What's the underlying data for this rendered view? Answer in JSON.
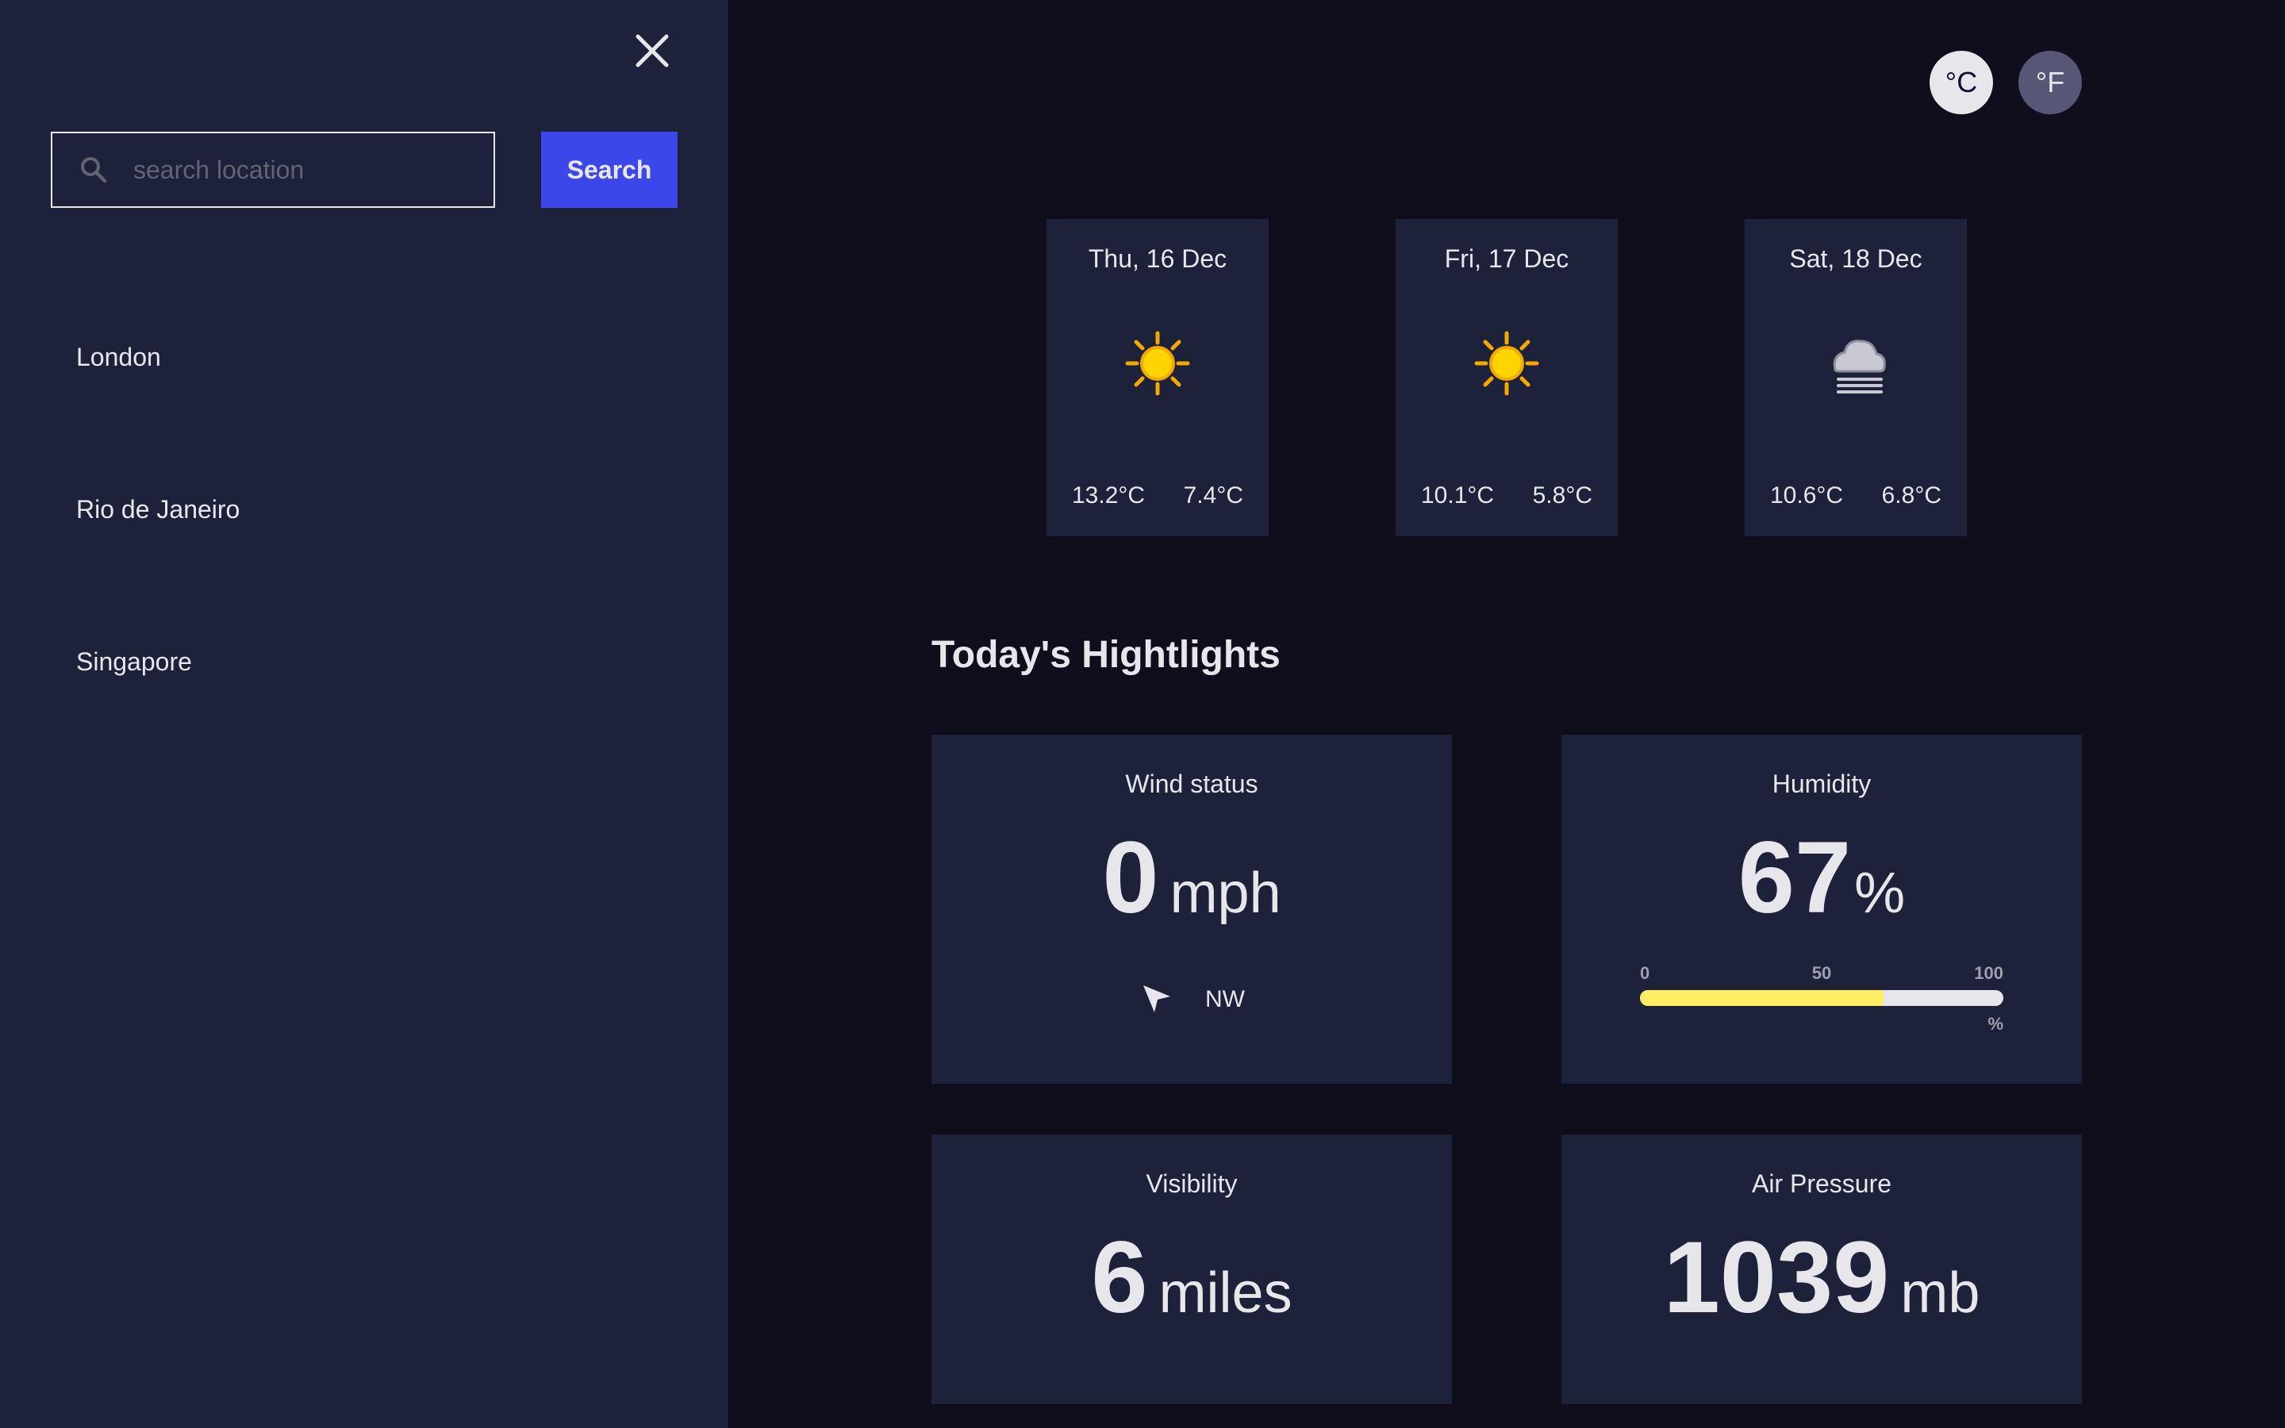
{
  "sidebar": {
    "search": {
      "placeholder": "search location",
      "value": ""
    },
    "search_button": "Search",
    "locations": [
      "London",
      "Rio de Janeiro",
      "Singapore"
    ]
  },
  "units": {
    "celsius": "°C",
    "fahrenheit": "°F",
    "active": "celsius"
  },
  "forecast": [
    {
      "day": "Thu, 16 Dec",
      "icon": "sun-icon",
      "max": "13.2°C",
      "min": "7.4°C"
    },
    {
      "day": "Fri, 17 Dec",
      "icon": "sun-icon",
      "max": "10.1°C",
      "min": "5.8°C"
    },
    {
      "day": "Sat, 18 Dec",
      "icon": "fog-cloud-icon",
      "max": "10.6°C",
      "min": "6.8°C"
    }
  ],
  "highlights": {
    "title": "Today's Hightlights",
    "wind": {
      "label": "Wind status",
      "value": "0",
      "unit": "mph",
      "direction": "NW",
      "icon": "navigation-arrow-icon"
    },
    "humidity": {
      "label": "Humidity",
      "value": "67",
      "unit": "%",
      "percent": 67,
      "scale_min": "0",
      "scale_mid": "50",
      "scale_max": "100",
      "scale_unit": "%"
    },
    "visibility": {
      "label": "Visibility",
      "value": "6",
      "unit": "miles"
    },
    "pressure": {
      "label": "Air Pressure",
      "value": "1039",
      "unit": "mb"
    }
  },
  "colors": {
    "sidebar_bg": "#1e213a",
    "main_bg": "#100e1d",
    "accent_blue": "#3c47e9",
    "humidity_fill": "#ffec65",
    "sun": "#ffd400"
  }
}
